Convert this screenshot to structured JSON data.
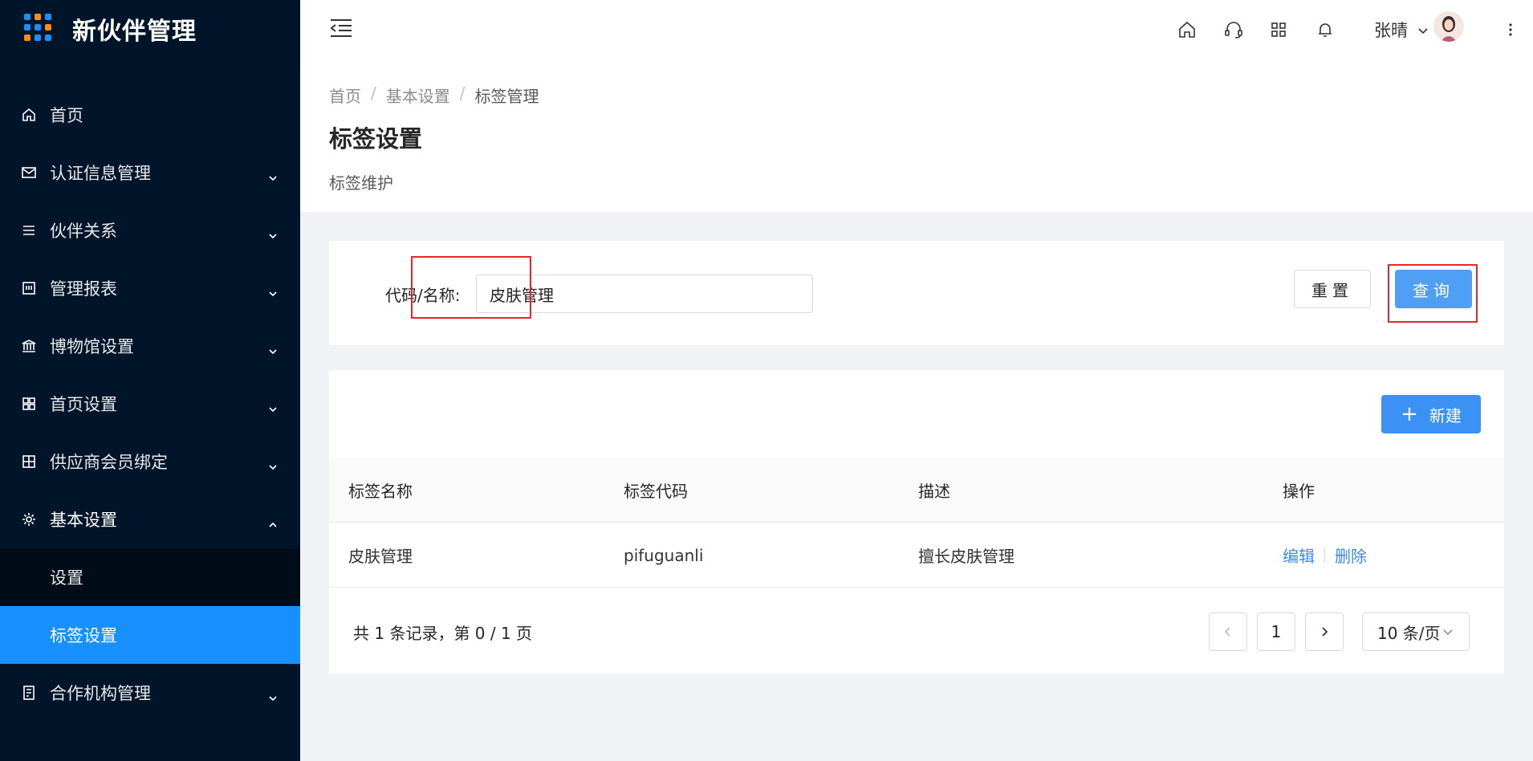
{
  "app": {
    "title": "新伙伴管理"
  },
  "sidebar": {
    "items": [
      {
        "label": "首页",
        "icon": "home-icon",
        "expandable": false
      },
      {
        "label": "认证信息管理",
        "icon": "mail-icon",
        "expandable": true
      },
      {
        "label": "伙伴关系",
        "icon": "list-icon",
        "expandable": true
      },
      {
        "label": "管理报表",
        "icon": "report-icon",
        "expandable": true
      },
      {
        "label": "博物馆设置",
        "icon": "museum-icon",
        "expandable": true
      },
      {
        "label": "首页设置",
        "icon": "grid-icon",
        "expandable": true
      },
      {
        "label": "供应商会员绑定",
        "icon": "bind-icon",
        "expandable": true
      },
      {
        "label": "基本设置",
        "icon": "gear-icon",
        "expandable": true,
        "open": true,
        "children": [
          {
            "label": "设置"
          },
          {
            "label": "标签设置",
            "active": true
          }
        ]
      },
      {
        "label": "合作机构管理",
        "icon": "org-icon",
        "expandable": true
      }
    ]
  },
  "header": {
    "icons": [
      "home-icon",
      "headset-icon",
      "apps-icon",
      "bell-icon"
    ],
    "username": "张晴"
  },
  "page": {
    "breadcrumb": [
      "首页",
      "基本设置",
      "标签管理"
    ],
    "title": "标签设置",
    "subtitle": "标签维护"
  },
  "search": {
    "label": "代码/名称:",
    "value": "皮肤管理",
    "reset_label": "重置",
    "query_label": "查询"
  },
  "table": {
    "new_label": "新建",
    "columns": [
      "标签名称",
      "标签代码",
      "描述",
      "操作"
    ],
    "rows": [
      {
        "name": "皮肤管理",
        "code": "pifuguanli",
        "desc": "擅长皮肤管理",
        "edit": "编辑",
        "delete": "删除"
      }
    ]
  },
  "pagination": {
    "total_text": "共 1 条记录，第 0 / 1 页",
    "current_page": "1",
    "page_size": "10 条/页"
  },
  "colors": {
    "sidebar_bg": "#001529",
    "submenu_bg": "#000c17",
    "primary": "#1890ff",
    "query_button": "#4f9ff5",
    "link": "#3b8bed",
    "highlight_box": "#e8262a"
  }
}
